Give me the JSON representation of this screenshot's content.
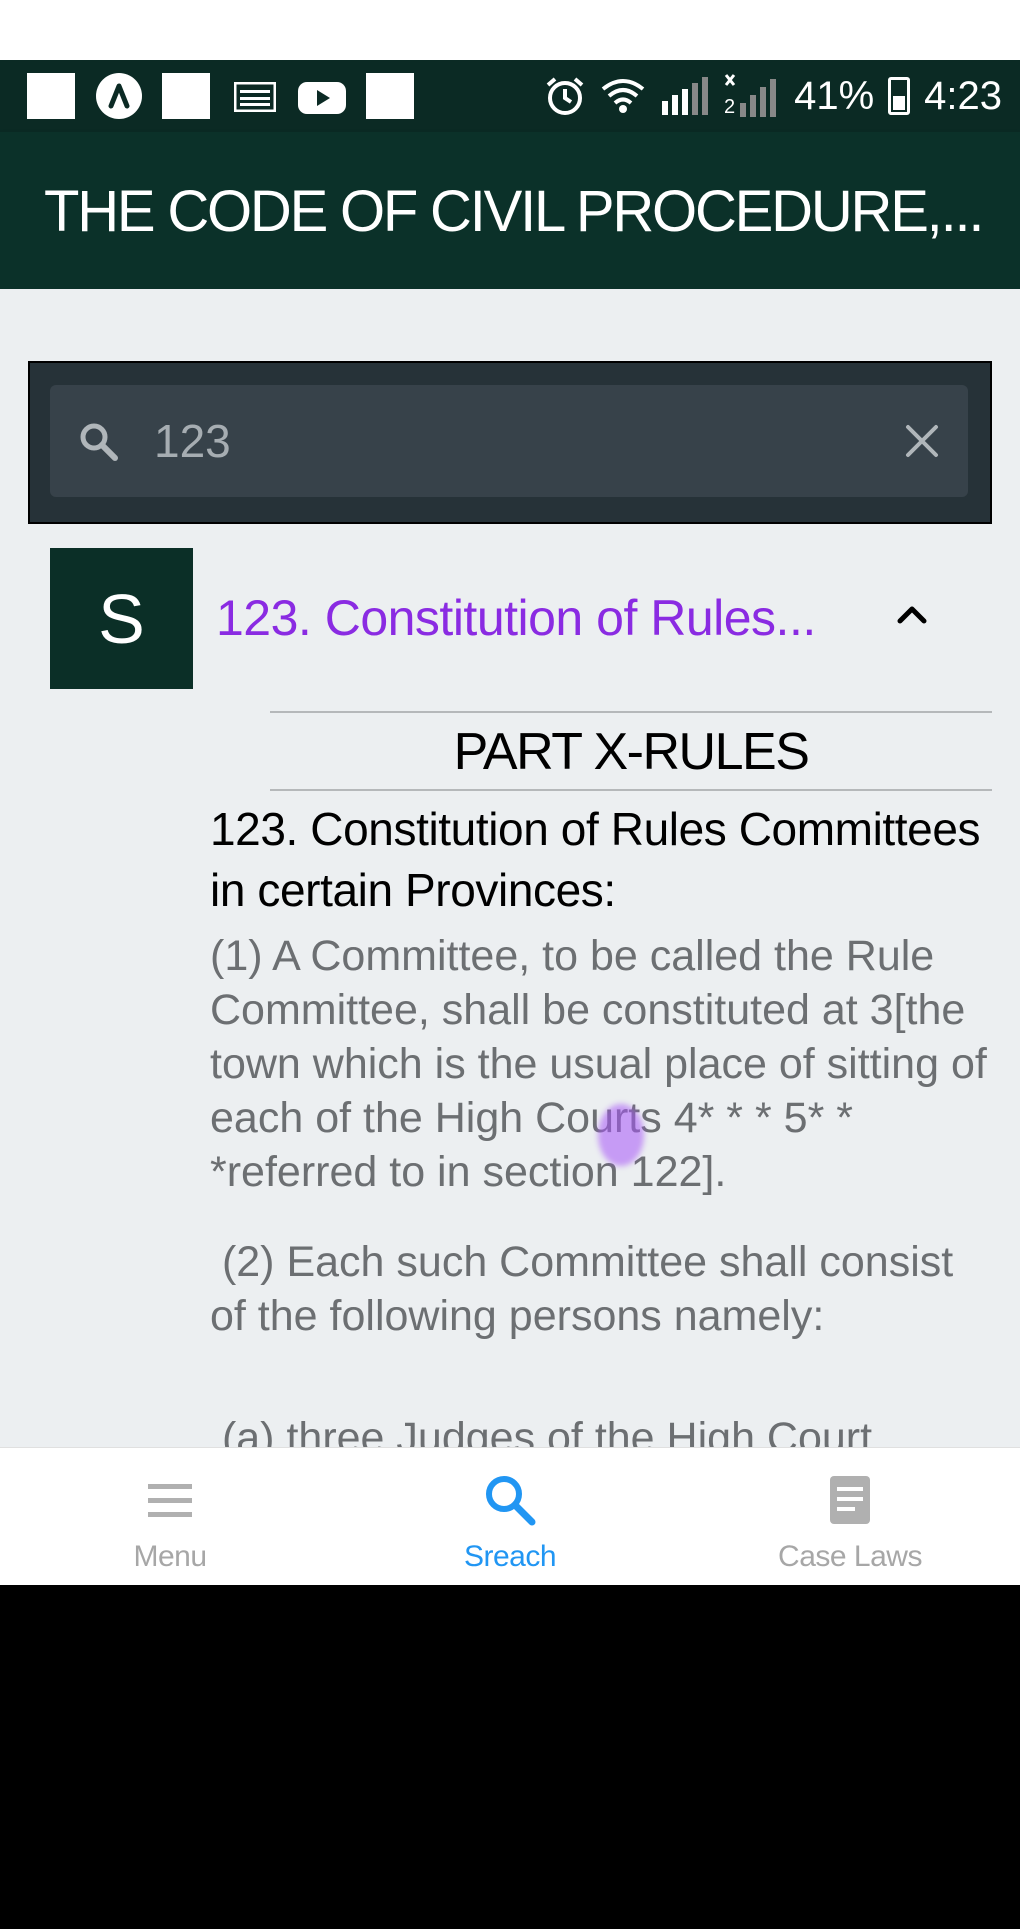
{
  "status_bar": {
    "battery_percent": "41%",
    "time": "4:23",
    "icons": [
      "app-square-icon",
      "airbnb-icon",
      "app-square-icon",
      "image-icon",
      "youtube-icon",
      "app-square-icon",
      "alarm-icon",
      "wifi-icon",
      "signal-icon",
      "signal-x-icon",
      "battery-icon"
    ]
  },
  "toolbar": {
    "title": "THE CODE OF CIVIL PROCEDURE,..."
  },
  "search": {
    "value": "123"
  },
  "result": {
    "badge": "S",
    "title": "123. Constitution of Rules...",
    "title_color": "#8a2be2",
    "part_heading": "PART X-RULES",
    "section_heading": "123. Constitution of Rules Committees in certain Provinces:",
    "paragraphs": [
      "(1) A Committee, to be called the Rule Committee, shall be constituted at 3[the town which is the usual place of sitting of each of the High Courts 4* * * 5* * *referred to in section 122].",
      " (2) Each such Committee shall consist of the following persons namely:",
      " (a) three Judges of the High Court"
    ]
  },
  "bottom_nav": {
    "items": [
      {
        "label": "Menu",
        "icon": "menu-icon"
      },
      {
        "label": "Sreach",
        "icon": "search-icon",
        "active": true
      },
      {
        "label": "Case Laws",
        "icon": "document-icon"
      }
    ],
    "active_color": "#2196f3"
  },
  "colors": {
    "primary_dark": "#0b3129",
    "search_card": "#263238",
    "content_bg": "#eceff1"
  }
}
